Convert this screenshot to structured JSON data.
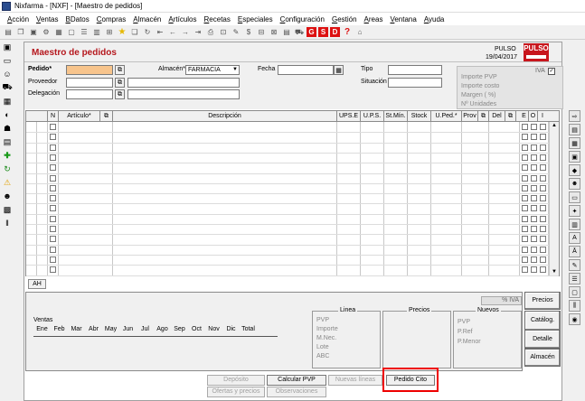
{
  "window": {
    "title": "Nixfarma - [NXF] - [Maestro de pedidos]"
  },
  "menu": [
    "Acción",
    "Ventas",
    "BDatos",
    "Compras",
    "Almacén",
    "Artículos",
    "Recetas",
    "Especiales",
    "Configuración",
    "Gestión",
    "Areas",
    "Ventana",
    "Ayuda"
  ],
  "toolbar": {
    "red_buttons": [
      "G",
      "S",
      "D"
    ],
    "help_label": "?"
  },
  "header": {
    "title": "Maestro de pedidos",
    "brand": "PULSO",
    "date": "19/04/2017",
    "logo_text": "PULSO"
  },
  "form": {
    "pedido_label": "Pedido*",
    "pedido_value": "",
    "proveedor_label": "Proveedor",
    "delegacion_label": "Delegación",
    "almacen_label": "Almacén*",
    "almacen_value": "FARMACIA",
    "fecha_label": "Fecha",
    "tipo_label": "Tipo",
    "situacion_label": "Situación"
  },
  "totals": {
    "iva_label": "IVA",
    "importe_pvp": "Importe PVP",
    "importe_costo": "Importe costo",
    "margen": "Margen (           %)",
    "n_unidades": "Nº Unidades"
  },
  "grid": {
    "columns": [
      "N",
      "Artículo*",
      "Descripción",
      "UPS.E",
      "U.P.S.",
      "St.Mín.",
      "Stock",
      "U.Ped.*",
      "Prov",
      "Del",
      "E",
      "O",
      "I"
    ],
    "rows": 15
  },
  "grid_buttons": {
    "ah": "AH"
  },
  "bottom": {
    "iva": "% IVA",
    "ventas_label": "Ventas",
    "months": [
      "Ene",
      "Feb",
      "Mar",
      "Abr",
      "May",
      "Jun",
      "Jul",
      "Ago",
      "Sep",
      "Oct",
      "Nov",
      "Dic",
      "Total"
    ],
    "linea": {
      "header": "Linea",
      "items": [
        "PVP",
        "Importe",
        "M.Nec.",
        "Lote",
        "ABC"
      ]
    },
    "precios": {
      "header": "Precios"
    },
    "nuevos": {
      "header": "Nuevos",
      "items": [
        "PVP",
        "P.Ref",
        "P.Menor"
      ]
    }
  },
  "side_buttons": [
    "Precios",
    "Catálog.",
    "Detalle",
    "Almacén"
  ],
  "footer_buttons": {
    "deposito": "Depósito",
    "calcular_pvp": "Calcular PVP",
    "nuevas_lineas": "Nuevas líneas",
    "pedido_cito": "Pedido Cito",
    "ofertas_precios": "Ofertas y precios",
    "observaciones": "Observaciones"
  }
}
